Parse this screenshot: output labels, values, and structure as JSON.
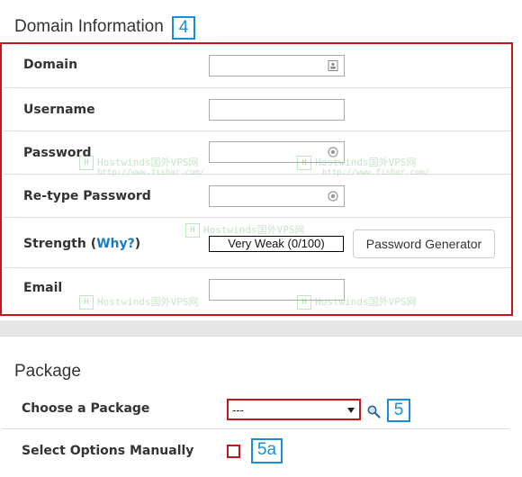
{
  "domain_section": {
    "title": "Domain Information",
    "step": "4",
    "fields": {
      "domain_label": "Domain",
      "username_label": "Username",
      "password_label": "Password",
      "retype_label": "Re-type Password",
      "strength_label_prefix": "Strength (",
      "strength_link": "Why?",
      "strength_label_suffix": ")",
      "strength_value": "Very Weak (0/100)",
      "password_generator_button": "Password Generator",
      "email_label": "Email"
    }
  },
  "package_section": {
    "title": "Package",
    "choose_label": "Choose a Package",
    "select_value": "---",
    "step": "5",
    "options_label": "Select Options Manually",
    "checkbox_step": "5a"
  },
  "watermark": {
    "brand": "Hostwinds国外VPS网",
    "url": "http://www.fishar.com/"
  },
  "colors": {
    "highlight_red": "#c4161c",
    "step_blue": "#1a8cd8",
    "link_blue": "#1a7bbf"
  }
}
